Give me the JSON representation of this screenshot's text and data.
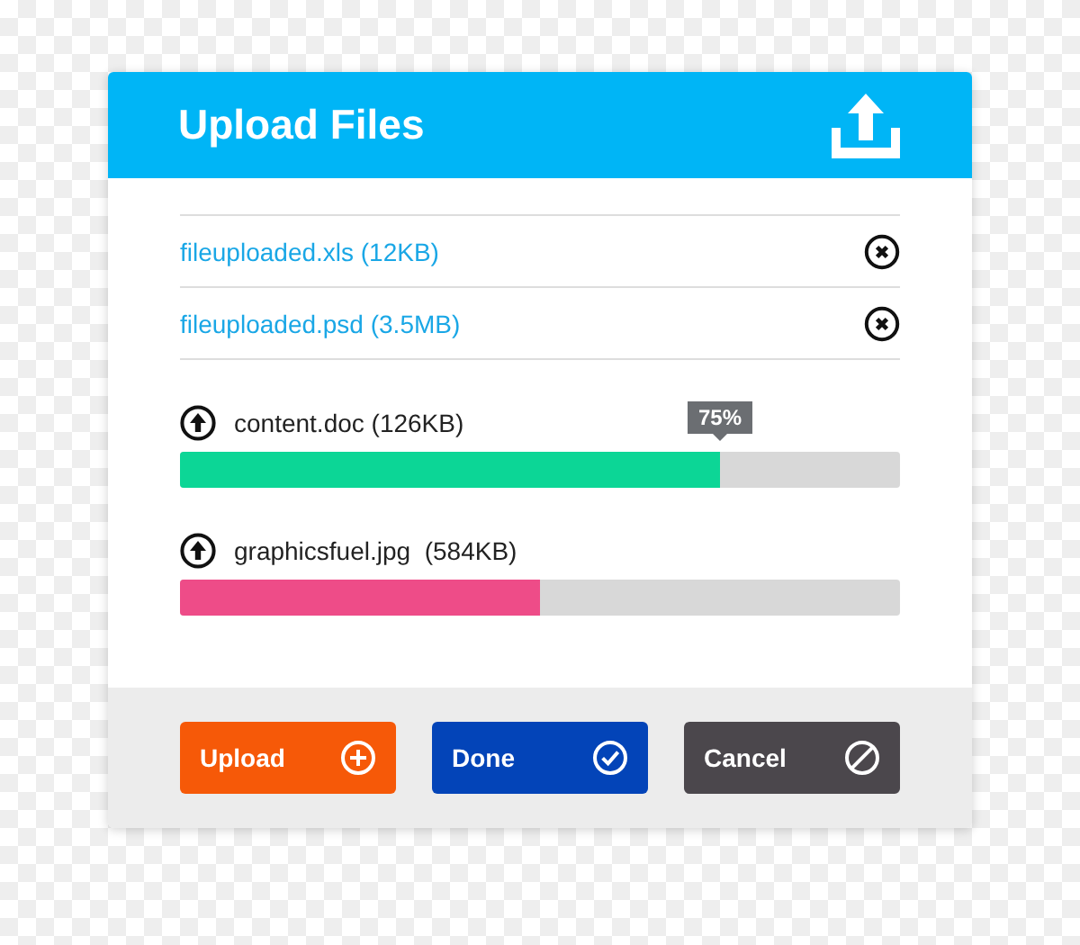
{
  "dialog": {
    "title": "Upload Files"
  },
  "uploaded_files": [
    {
      "label": "fileuploaded.xls (12KB)"
    },
    {
      "label": "fileuploaded.psd (3.5MB)"
    }
  ],
  "uploads": [
    {
      "label": "content.doc (126KB)",
      "level": 0.75,
      "color": "#0cd696",
      "tooltip": "75%"
    },
    {
      "label": "graphicsfuel.jpg  (584KB)",
      "level": 0.5,
      "color": "#ee4c88"
    }
  ],
  "buttons": [
    {
      "label": "Upload",
      "kind": "upload",
      "color": "#f65908"
    },
    {
      "label": "Done",
      "kind": "done",
      "color": "#0344b8"
    },
    {
      "label": "Cancel",
      "kind": "cancel",
      "color": "#4b474c"
    }
  ]
}
